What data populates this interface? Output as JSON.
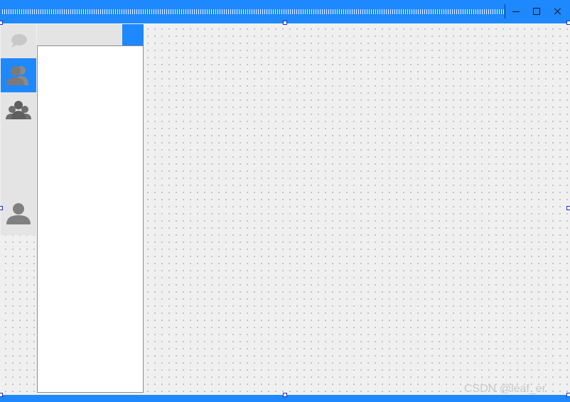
{
  "window": {
    "minimize_icon": "minimize-icon",
    "maximize_icon": "maximize-icon",
    "close_icon": "close-icon",
    "accent_color": "#1e88ff"
  },
  "sidebar": {
    "items": [
      {
        "icon": "chat-bubble-icon",
        "active": false
      },
      {
        "icon": "contacts-icon",
        "active": true
      },
      {
        "icon": "group-icon",
        "active": false
      },
      {
        "icon": "user-profile-icon",
        "active": false
      }
    ]
  },
  "search": {
    "value": "",
    "placeholder": ""
  },
  "watermark": {
    "text": "CSDN @leaf_er"
  }
}
